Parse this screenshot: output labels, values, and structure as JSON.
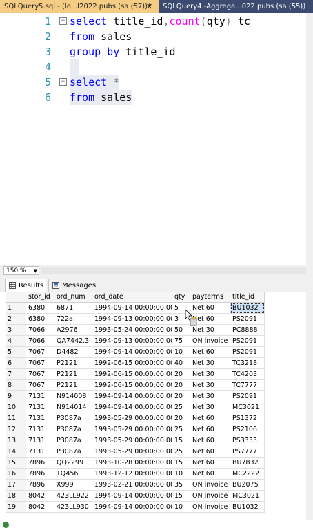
{
  "tabs": {
    "active": "SQLQuery5.sql - (lo...I2022.pubs (sa (57))*",
    "active_pin": "⊣",
    "active_close": "✕",
    "inactive": "SQLQuery4.-Aggrega...022.pubs (sa (55))"
  },
  "editor": {
    "lines": [
      {
        "num": "1",
        "tokens": [
          {
            "t": "select ",
            "c": "kw"
          },
          {
            "t": "title_id",
            "c": "plain"
          },
          {
            "t": ",",
            "c": "gray"
          },
          {
            "t": "count",
            "c": "fn"
          },
          {
            "t": "(",
            "c": "gray"
          },
          {
            "t": "qty",
            "c": "plain"
          },
          {
            "t": ")",
            "c": "gray"
          },
          {
            "t": " tc",
            "c": "plain"
          }
        ]
      },
      {
        "num": "2",
        "tokens": [
          {
            "t": "from ",
            "c": "kw"
          },
          {
            "t": "sales",
            "c": "plain"
          }
        ]
      },
      {
        "num": "3",
        "tokens": [
          {
            "t": "group by ",
            "c": "kw"
          },
          {
            "t": "title_id",
            "c": "plain"
          }
        ]
      },
      {
        "num": "4",
        "tokens": []
      },
      {
        "num": "5",
        "tokens": [
          {
            "t": "select ",
            "c": "kw"
          },
          {
            "t": "*",
            "c": "gray"
          }
        ]
      },
      {
        "num": "6",
        "tokens": [
          {
            "t": "from ",
            "c": "kw"
          },
          {
            "t": "sales",
            "c": "plain"
          }
        ]
      }
    ]
  },
  "zoom": "150 %",
  "result_tabs": {
    "results": "Results",
    "messages": "Messages"
  },
  "grid": {
    "columns": [
      "stor_id",
      "ord_num",
      "ord_date",
      "qty",
      "payterms",
      "title_id"
    ],
    "rows": [
      [
        "1",
        "6380",
        "6871",
        "1994-09-14 00:00:00.000",
        "5",
        "Net 60",
        "BU1032"
      ],
      [
        "2",
        "6380",
        "722a",
        "1994-09-13 00:00:00.000",
        "3",
        "Net 60",
        "PS2091"
      ],
      [
        "3",
        "7066",
        "A2976",
        "1993-05-24 00:00:00.000",
        "50",
        "Net 30",
        "PC8888"
      ],
      [
        "4",
        "7066",
        "QA7442.3",
        "1994-09-13 00:00:00.000",
        "75",
        "ON invoice",
        "PS2091"
      ],
      [
        "5",
        "7067",
        "D4482",
        "1994-09-14 00:00:00.000",
        "10",
        "Net 60",
        "PS2091"
      ],
      [
        "6",
        "7067",
        "P2121",
        "1992-06-15 00:00:00.000",
        "40",
        "Net 30",
        "TC3218"
      ],
      [
        "7",
        "7067",
        "P2121",
        "1992-06-15 00:00:00.000",
        "20",
        "Net 30",
        "TC4203"
      ],
      [
        "8",
        "7067",
        "P2121",
        "1992-06-15 00:00:00.000",
        "20",
        "Net 30",
        "TC7777"
      ],
      [
        "9",
        "7131",
        "N914008",
        "1994-09-14 00:00:00.000",
        "20",
        "Net 30",
        "PS2091"
      ],
      [
        "10",
        "7131",
        "N914014",
        "1994-09-14 00:00:00.000",
        "25",
        "Net 30",
        "MC3021"
      ],
      [
        "11",
        "7131",
        "P3087a",
        "1993-05-29 00:00:00.000",
        "20",
        "Net 60",
        "PS1372"
      ],
      [
        "12",
        "7131",
        "P3087a",
        "1993-05-29 00:00:00.000",
        "25",
        "Net 60",
        "PS2106"
      ],
      [
        "13",
        "7131",
        "P3087a",
        "1993-05-29 00:00:00.000",
        "15",
        "Net 60",
        "PS3333"
      ],
      [
        "14",
        "7131",
        "P3087a",
        "1993-05-29 00:00:00.000",
        "25",
        "Net 60",
        "PS7777"
      ],
      [
        "15",
        "7896",
        "QQ2299",
        "1993-10-28 00:00:00.000",
        "15",
        "Net 60",
        "BU7832"
      ],
      [
        "16",
        "7896",
        "TQ456",
        "1993-12-12 00:00:00.000",
        "10",
        "Net 60",
        "MC2222"
      ],
      [
        "17",
        "7896",
        "X999",
        "1993-02-21 00:00:00.000",
        "35",
        "ON invoice",
        "BU2075"
      ],
      [
        "18",
        "8042",
        "423LL922",
        "1994-09-14 00:00:00.000",
        "15",
        "ON invoice",
        "MC3021"
      ],
      [
        "19",
        "8042",
        "423LL930",
        "1994-09-14 00:00:00.000",
        "10",
        "ON invoice",
        "BU1032"
      ]
    ]
  },
  "colors": {
    "keyword": "#0000ff",
    "function": "#ff00ff",
    "line_number": "#2b91af",
    "tab_active": "#f5cc84"
  },
  "icons": [
    "pin-icon",
    "close-icon",
    "collapse-icon",
    "grid-icon",
    "messages-icon",
    "mouse-cursor-icon",
    "status-icon"
  ]
}
